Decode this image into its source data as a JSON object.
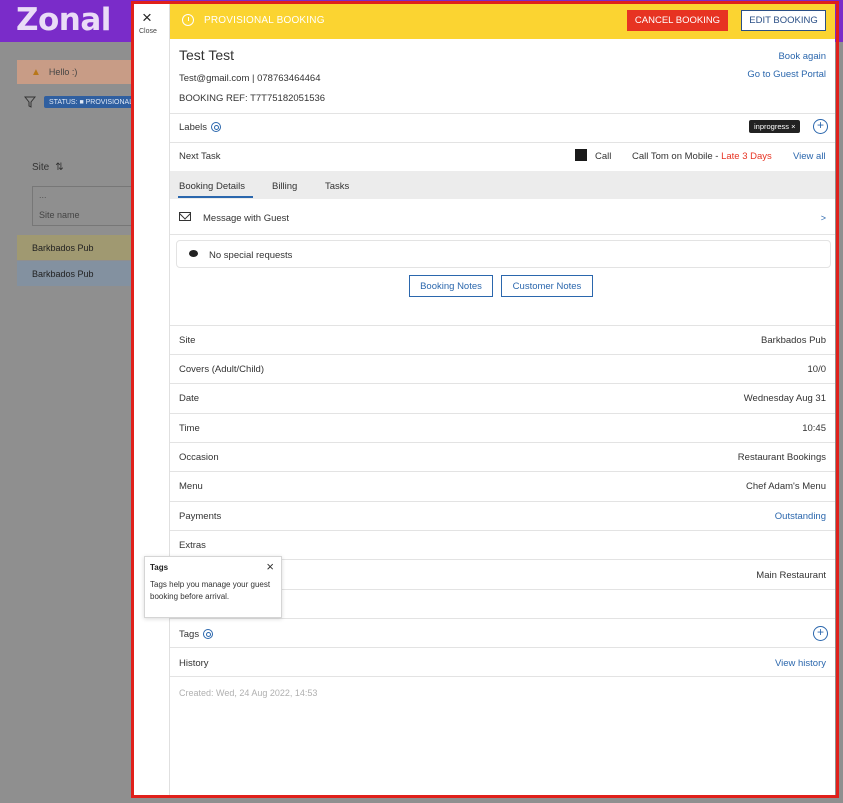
{
  "background": {
    "logo": "Zonal",
    "alert_text": "Hello :)",
    "filter_chip": "STATUS: ■ PROVISIONAL ×",
    "site_header": "Site",
    "sort_icon": "⇅",
    "sitename_dots": "...",
    "sitename_label": "Site name",
    "rows": [
      "Barkbados Pub",
      "Barkbados Pub"
    ]
  },
  "close": {
    "icon": "×",
    "label": "Close"
  },
  "topbar": {
    "title": "PROVISIONAL BOOKING",
    "cancel_label": "CANCEL BOOKING",
    "edit_label": "EDIT BOOKING",
    "color": "#fbd431"
  },
  "guest": {
    "name": "Test Test",
    "contact": "Test@gmail.com  |  078763464464",
    "booking_ref": "BOOKING REF: T7T75182051536",
    "book_again": "Book again",
    "guest_portal": "Go to Guest Portal"
  },
  "labels": {
    "label": "Labels",
    "chip": "inprogress ×",
    "add": "+"
  },
  "next_task": {
    "label": "Next Task",
    "type": "Call",
    "desc": "Call Tom on Mobile - ",
    "late": "Late 3 Days",
    "view_all": "View all"
  },
  "tabs": [
    "Booking Details",
    "Billing",
    "Tasks"
  ],
  "message": {
    "label": "Message with Guest",
    "chevron": ">"
  },
  "special_requests": "No special requests",
  "notes": {
    "booking": "Booking Notes",
    "customer": "Customer Notes"
  },
  "details": [
    {
      "label": "Site",
      "value": "Barkbados Pub"
    },
    {
      "label": "Covers (Adult/Child)",
      "value": "10/0"
    },
    {
      "label": "Date",
      "value": "Wednesday Aug 31"
    },
    {
      "label": "Time",
      "value": "10:45"
    },
    {
      "label": "Occasion",
      "value": "Restaurant Bookings"
    },
    {
      "label": "Menu",
      "value": "Chef Adam's Menu"
    },
    {
      "label": "Payments",
      "value": "Outstanding"
    },
    {
      "label": "Extras",
      "value": ""
    },
    {
      "label": "",
      "value": "Main Restaurant"
    }
  ],
  "tags": {
    "label": "Tags",
    "add": "+"
  },
  "history": {
    "label": "History",
    "link": "View history"
  },
  "created": "Created: Wed, 24 Aug 2022, 14:53",
  "tooltip": {
    "title": "Tags",
    "close": "×",
    "body": "Tags help you manage your guest booking before arrival."
  },
  "colors": {
    "accent": "#2b67ad",
    "danger": "#e73322",
    "highlight": "#e0201b",
    "brand": "#7a2cc9"
  }
}
